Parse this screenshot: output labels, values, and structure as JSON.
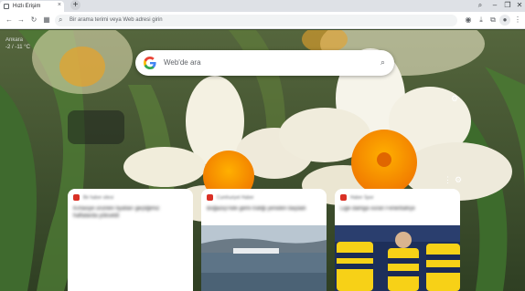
{
  "tab": {
    "title": "Hızlı Erişim",
    "close": "×"
  },
  "newtab": "+",
  "window": {
    "search": "⌕",
    "minimize": "–",
    "restore": "❐",
    "close": "✕"
  },
  "toolbar": {
    "back": "←",
    "forward": "→",
    "reload": "↻",
    "apps": "▦",
    "omnibox_placeholder": "Bir arama terimi veya Web adresi girin",
    "lens": "◉",
    "downloads": "⤓",
    "extensions": "⧉",
    "profile": "●",
    "menu": "⋮"
  },
  "weather": {
    "title": "Ankara",
    "temp": "-2 / -11 °C"
  },
  "search": {
    "placeholder": "Web'de ara"
  },
  "controls": {
    "gear": "⚙",
    "more": "⋮",
    "settings": "⚙"
  },
  "cards": [
    {
      "source": "Bir haber sitesi",
      "title": "Kırtasiye ürünleri fiyatları geçtiğimiz haftalarda yükseldi",
      "favicon_color": "#d93025"
    },
    {
      "source": "Cumhuriyet Haber",
      "title": "Boğaziçi'nde gemi trafiği yeniden başladı",
      "favicon_color": "#d93025"
    },
    {
      "source": "Haber Spor",
      "title": "Lige damga vuran Fenerbahçe",
      "favicon_color": "#d93025"
    }
  ],
  "colors": {
    "accent": "#1a73e8",
    "tabstrip": "#dee1e6"
  }
}
